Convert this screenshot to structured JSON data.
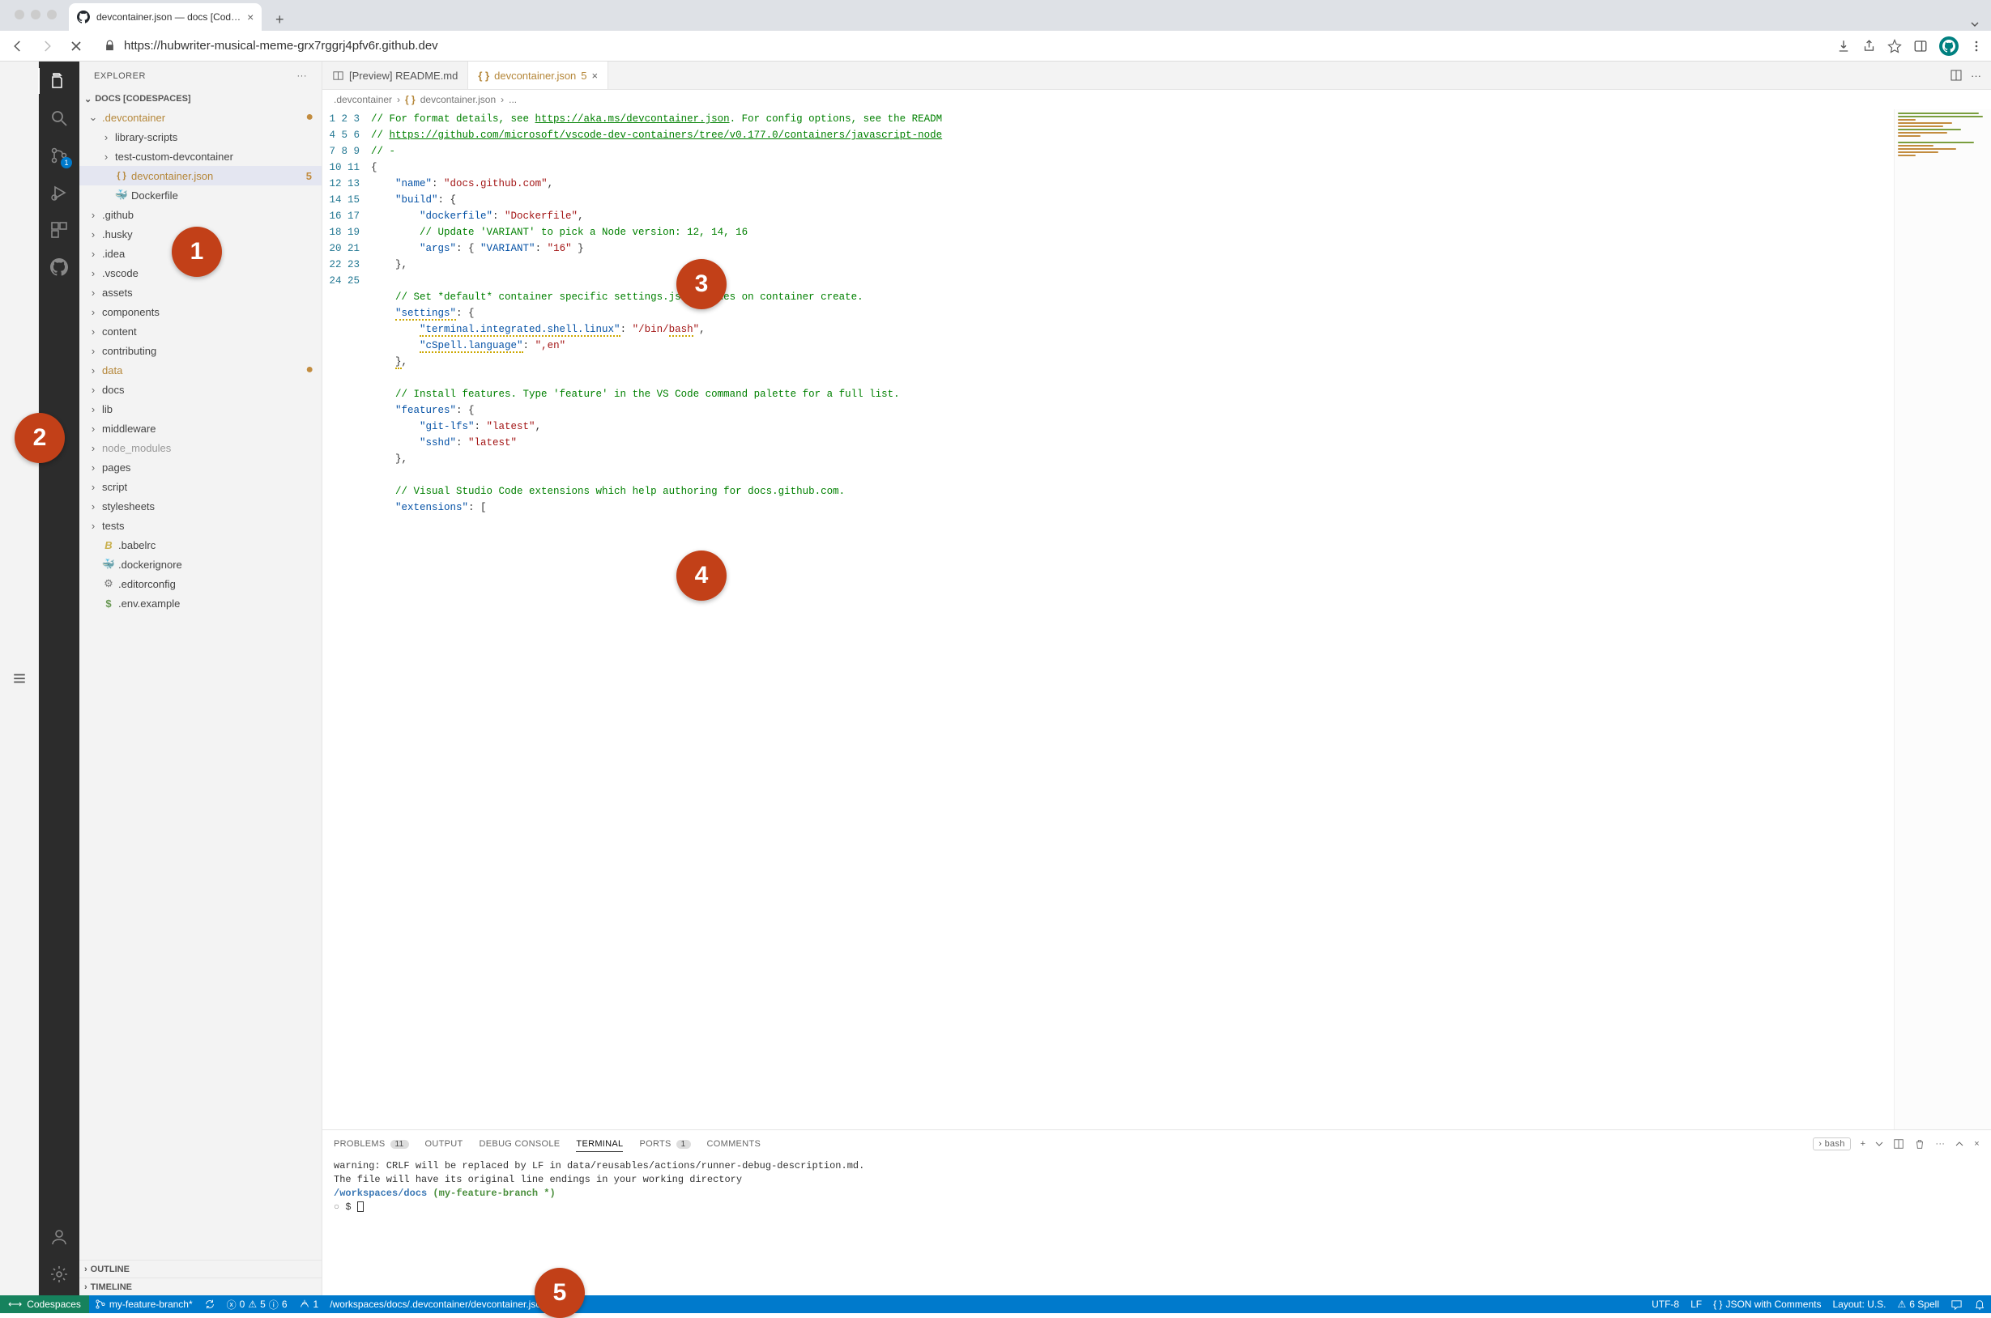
{
  "browser": {
    "tab_title": "devcontainer.json — docs [Cod…",
    "url": "https://hubwriter-musical-meme-grx7rggrj4pfv6r.github.dev"
  },
  "explorer": {
    "title": "EXPLORER",
    "section": "DOCS [CODESPACES]",
    "tree": [
      {
        "type": "folder",
        "name": ".devcontainer",
        "expanded": true,
        "modified": true,
        "depth": 0
      },
      {
        "type": "folder",
        "name": "library-scripts",
        "expanded": false,
        "depth": 1
      },
      {
        "type": "folder",
        "name": "test-custom-devcontainer",
        "expanded": false,
        "depth": 1
      },
      {
        "type": "file",
        "name": "devcontainer.json",
        "icon": "json",
        "selected": true,
        "badge": "5",
        "modified": true,
        "depth": 1
      },
      {
        "type": "file",
        "name": "Dockerfile",
        "icon": "docker",
        "depth": 1
      },
      {
        "type": "folder",
        "name": ".github",
        "expanded": false,
        "depth": 0
      },
      {
        "type": "folder",
        "name": ".husky",
        "expanded": false,
        "depth": 0
      },
      {
        "type": "folder",
        "name": ".idea",
        "expanded": false,
        "depth": 0
      },
      {
        "type": "folder",
        "name": ".vscode",
        "expanded": false,
        "depth": 0
      },
      {
        "type": "folder",
        "name": "assets",
        "expanded": false,
        "depth": 0
      },
      {
        "type": "folder",
        "name": "components",
        "expanded": false,
        "depth": 0
      },
      {
        "type": "folder",
        "name": "content",
        "expanded": false,
        "depth": 0
      },
      {
        "type": "folder",
        "name": "contributing",
        "expanded": false,
        "depth": 0
      },
      {
        "type": "folder",
        "name": "data",
        "expanded": false,
        "modified": true,
        "depth": 0
      },
      {
        "type": "folder",
        "name": "docs",
        "expanded": false,
        "depth": 0
      },
      {
        "type": "folder",
        "name": "lib",
        "expanded": false,
        "depth": 0
      },
      {
        "type": "folder",
        "name": "middleware",
        "expanded": false,
        "depth": 0
      },
      {
        "type": "folder",
        "name": "node_modules",
        "expanded": false,
        "dim": true,
        "depth": 0
      },
      {
        "type": "folder",
        "name": "pages",
        "expanded": false,
        "depth": 0
      },
      {
        "type": "folder",
        "name": "script",
        "expanded": false,
        "depth": 0
      },
      {
        "type": "folder",
        "name": "stylesheets",
        "expanded": false,
        "depth": 0
      },
      {
        "type": "folder",
        "name": "tests",
        "expanded": false,
        "depth": 0
      },
      {
        "type": "file",
        "name": ".babelrc",
        "icon": "babel",
        "depth": 0
      },
      {
        "type": "file",
        "name": ".dockerignore",
        "icon": "docker-dim",
        "depth": 0
      },
      {
        "type": "file",
        "name": ".editorconfig",
        "icon": "gear",
        "depth": 0
      },
      {
        "type": "file",
        "name": ".env.example",
        "icon": "dollar",
        "depth": 0
      }
    ],
    "outline": "OUTLINE",
    "timeline": "TIMELINE"
  },
  "tabs": {
    "preview": "[Preview] README.md",
    "activeFile": "devcontainer.json",
    "activeCount": "5"
  },
  "breadcrumbs": {
    "a": ".devcontainer",
    "b": "devcontainer.json",
    "c": "..."
  },
  "scm_badge": "1",
  "panel": {
    "tabs": {
      "problems": "PROBLEMS",
      "problemsCount": "11",
      "output": "OUTPUT",
      "debug": "DEBUG CONSOLE",
      "terminal": "TERMINAL",
      "ports": "PORTS",
      "portsCount": "1",
      "comments": "COMMENTS"
    },
    "shell": "bash",
    "term": {
      "line1": "warning: CRLF will be replaced by LF in data/reusables/actions/runner-debug-description.md.",
      "line2": "The file will have its original line endings in your working directory",
      "cwd": "/workspaces/docs",
      "branch": "(my-feature-branch *)",
      "prompt": "$ "
    }
  },
  "status": {
    "codespaces": "Codespaces",
    "branch": "my-feature-branch*",
    "errors": "0",
    "warnings": "5",
    "info": "6",
    "ports": "1",
    "path": "/workspaces/docs/.devcontainer/devcontainer.json",
    "encoding": "UTF-8",
    "eol": "LF",
    "lang": "JSON with Comments",
    "layout": "Layout: U.S.",
    "spell": "6 Spell"
  },
  "callouts": {
    "c1": "1",
    "c2": "2",
    "c3": "3",
    "c4": "4",
    "c5": "5"
  }
}
